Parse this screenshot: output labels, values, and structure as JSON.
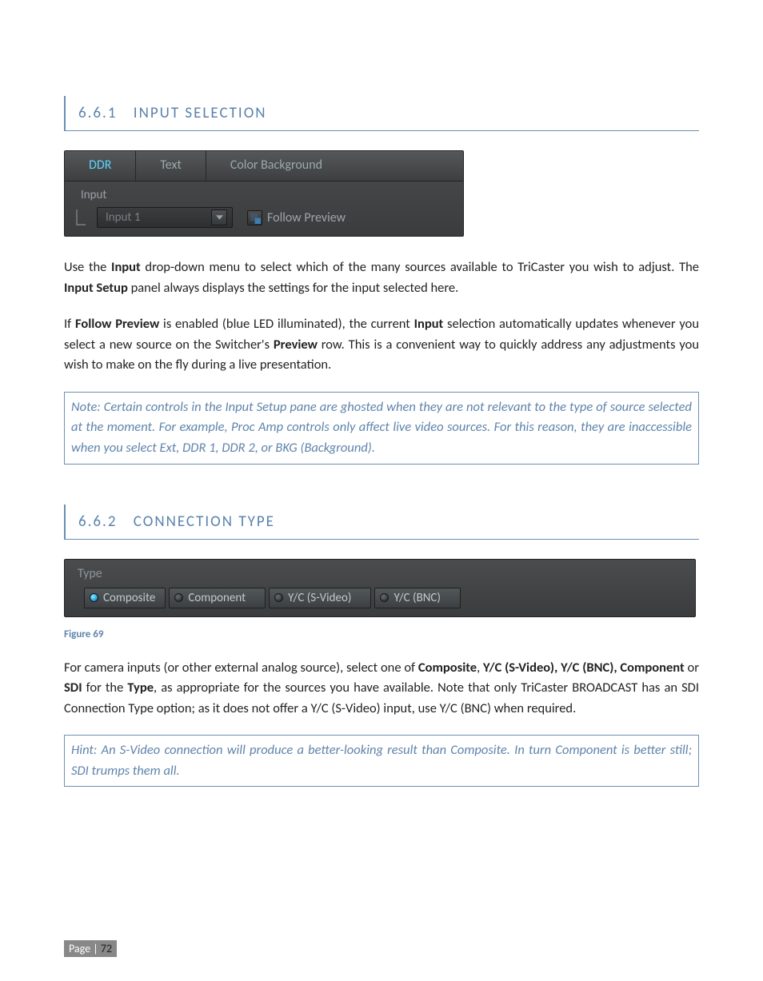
{
  "section1": {
    "number": "6.6.1",
    "title": "INPUT SELECTION"
  },
  "shot1": {
    "tabs": {
      "ddr": "DDR",
      "text": "Text",
      "bg": "Color Background"
    },
    "groupLabel": "Input",
    "selectValue": "Input 1",
    "followPreview": "Follow Preview"
  },
  "para1_a": "Use the ",
  "para1_b": "Input",
  "para1_c": " drop-down menu to select which of the many sources available to TriCaster you wish to adjust.  The ",
  "para1_d": "Input Setup",
  "para1_e": " panel always displays the settings for the input selected here.",
  "para2_a": "If ",
  "para2_b": "Follow Preview",
  "para2_c": " is enabled (blue LED illuminated), the current ",
  "para2_d": "Input",
  "para2_e": " selection automatically updates whenever you select a new source on the Switcher's ",
  "para2_f": "Preview",
  "para2_g": " row.  This is a convenient way to quickly address any adjustments you wish to make on the fly during a live presentation.",
  "note": "Note: Certain controls in the Input Setup pane are ghosted when they are not relevant to the type of source selected at the moment.  For example, Proc Amp controls only affect live video sources. For this reason, they are inaccessible when you select Ext, DDR 1, DDR 2, or BKG (Background).",
  "section2": {
    "number": "6.6.2",
    "title": "CONNECTION TYPE"
  },
  "shot2": {
    "groupLabel": "Type",
    "options": {
      "composite": "Composite",
      "component": "Component",
      "ycsvideo": "Y/C (S-Video)",
      "ycbnc": "Y/C (BNC)"
    }
  },
  "figLabel": "Figure 69",
  "para3_a": "For camera inputs (or other external analog source), select one of ",
  "para3_b": "Composite",
  "para3_c": ", ",
  "para3_d": "Y/C (S-Video), Y/C (BNC), Component",
  "para3_e": " or ",
  "para3_f": "SDI",
  "para3_g": " for the ",
  "para3_h": "Type",
  "para3_i": ", as appropriate for the sources you have available. Note that only TriCaster BROADCAST has an SDI Connection Type option; as it does not offer a Y/C (S-Video) input, use Y/C (BNC) when required.",
  "hint": "Hint: An S-Video connection will produce a better-looking result than Composite. In turn Component is better still; SDI trumps them all.",
  "footer": {
    "prefix": "Page | ",
    "num": "72"
  }
}
